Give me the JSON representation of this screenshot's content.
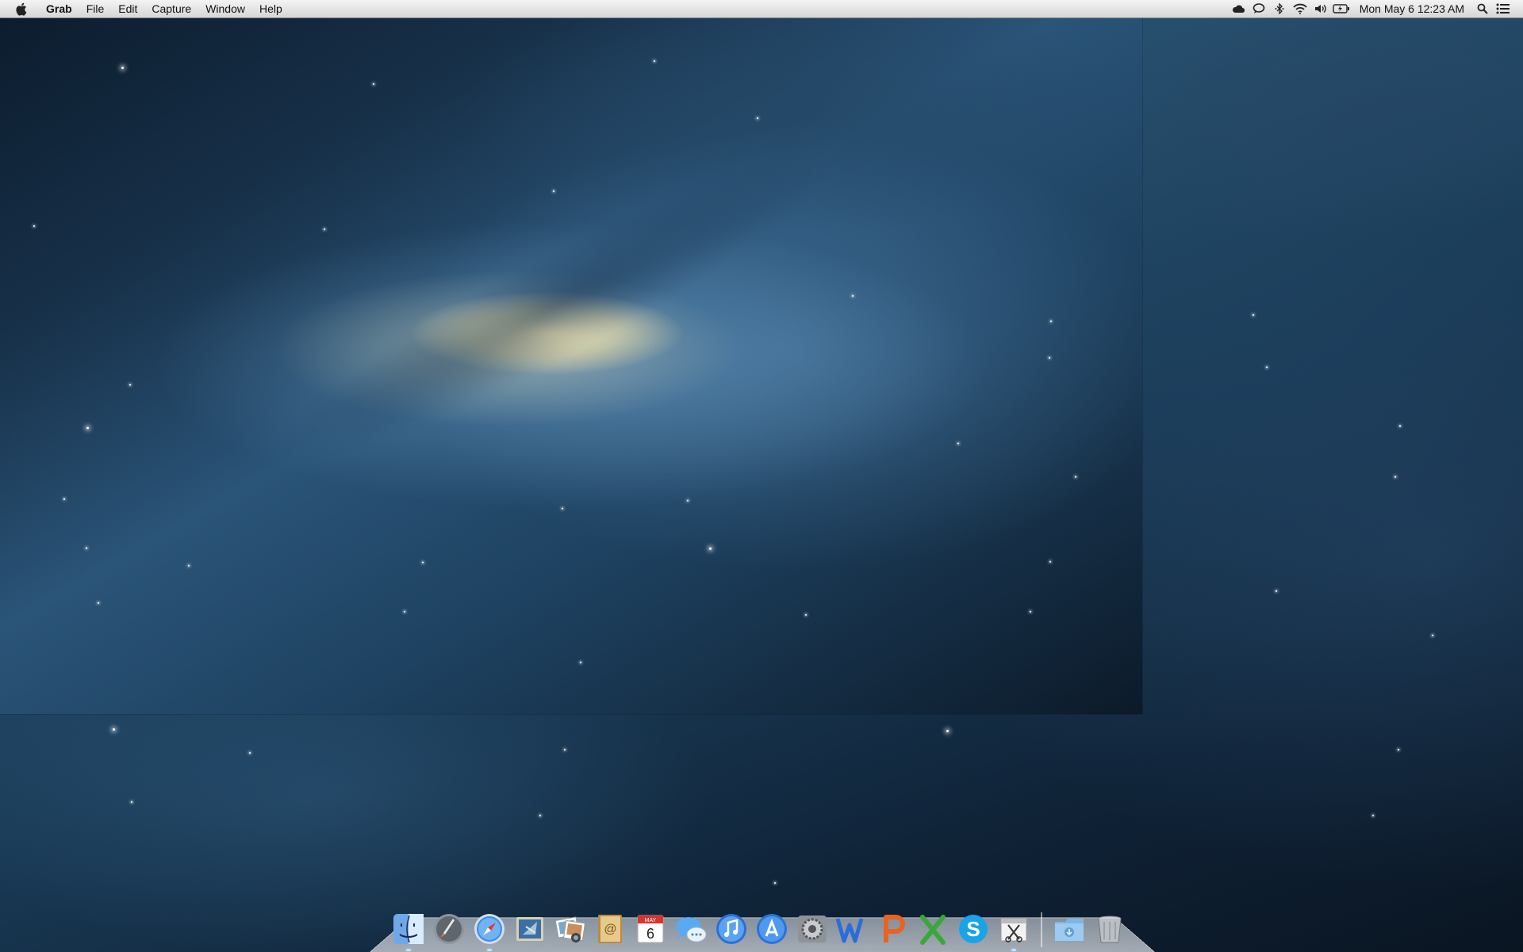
{
  "menubar": {
    "app_name": "Grab",
    "menus": [
      "File",
      "Edit",
      "Capture",
      "Window",
      "Help"
    ],
    "status_icons": [
      "cloud-icon",
      "chat-bubble-icon",
      "bluetooth-icon",
      "wifi-icon",
      "volume-icon",
      "battery-icon"
    ],
    "clock": "Mon May 6  12:23 AM"
  },
  "dock": {
    "apps": [
      {
        "name": "finder-icon",
        "running": true
      },
      {
        "name": "launchpad-icon",
        "running": false
      },
      {
        "name": "safari-icon",
        "running": true
      },
      {
        "name": "mail-icon",
        "running": false
      },
      {
        "name": "photos-icon",
        "running": false
      },
      {
        "name": "contacts-icon",
        "running": false
      },
      {
        "name": "calendar-icon",
        "running": false,
        "label_top": "MAY",
        "label_day": "6"
      },
      {
        "name": "messages-icon",
        "running": false
      },
      {
        "name": "itunes-icon",
        "running": false
      },
      {
        "name": "app-store-icon",
        "running": false
      },
      {
        "name": "system-preferences-icon",
        "running": false
      },
      {
        "name": "word-icon",
        "running": false
      },
      {
        "name": "powerpoint-icon",
        "running": false
      },
      {
        "name": "excel-icon",
        "running": false
      },
      {
        "name": "skype-icon",
        "running": false
      },
      {
        "name": "grab-icon",
        "running": true
      }
    ],
    "right": [
      {
        "name": "downloads-folder-icon"
      },
      {
        "name": "trash-icon"
      }
    ]
  }
}
